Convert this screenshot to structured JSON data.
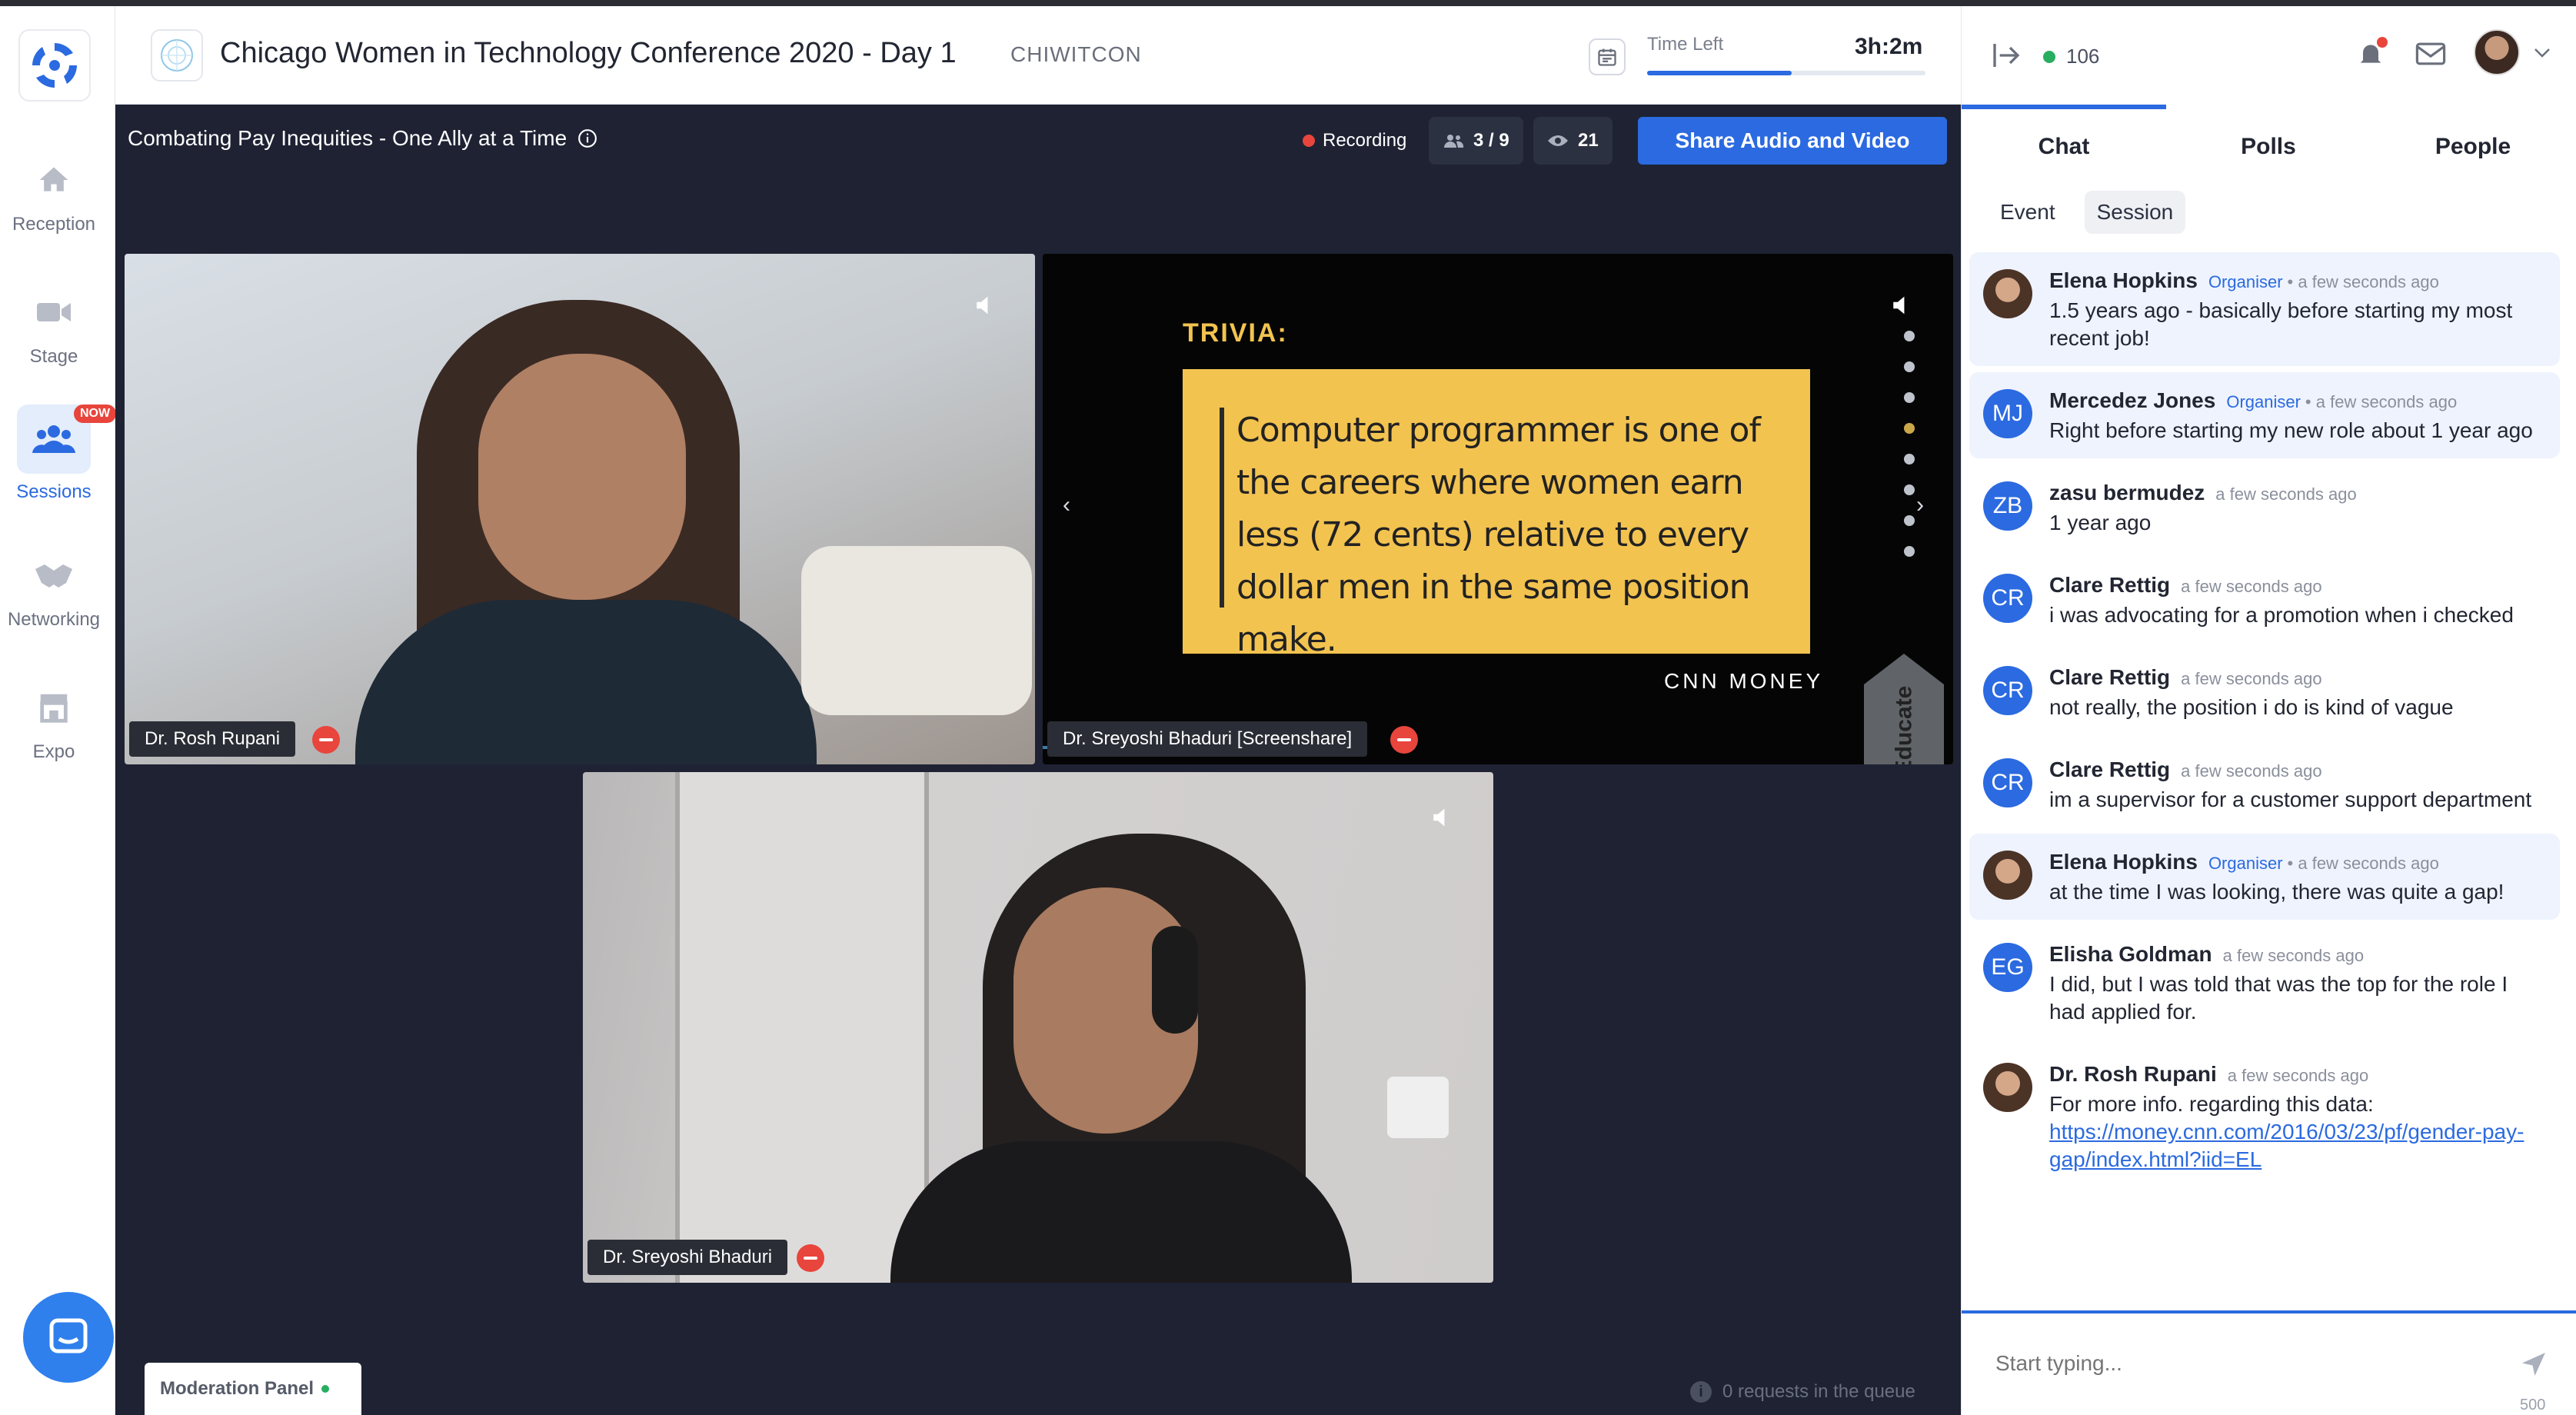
{
  "nav": {
    "items": [
      {
        "label": "Reception",
        "icon": "home-icon"
      },
      {
        "label": "Stage",
        "icon": "video-camera-icon"
      },
      {
        "label": "Sessions",
        "icon": "group-icon",
        "badge": "NOW"
      },
      {
        "label": "Networking",
        "icon": "handshake-icon"
      },
      {
        "label": "Expo",
        "icon": "store-icon"
      }
    ]
  },
  "header": {
    "title": "Chicago Women in Technology Conference 2020 - Day 1",
    "code": "CHIWITCON",
    "time_left_label": "Time Left",
    "time_left_value": "3h:2m",
    "time_progress": 0.52
  },
  "stage": {
    "session_title": "Combating Pay Inequities - One Ally at a Time",
    "recording_label": "Recording",
    "participants": "3 / 9",
    "viewers": "21",
    "share_button": "Share Audio and Video",
    "tiles": [
      {
        "name": "Dr. Rosh Rupani"
      },
      {
        "name": "Dr. Sreyoshi Bhaduri [Screenshare]"
      },
      {
        "name": "Dr. Sreyoshi Bhaduri"
      }
    ],
    "slide": {
      "heading": "TRIVIA:",
      "body": "Computer programmer is one of the careers where women earn less (72 cents) relative to every dollar men in the same position make.",
      "source": "CNN MONEY",
      "brand": "Educate"
    },
    "moderation_panel": "Moderation Panel",
    "queue_text": "0 requests in the queue"
  },
  "right": {
    "online_count": "106",
    "tabs": [
      "Chat",
      "Polls",
      "People"
    ],
    "subtabs": [
      "Event",
      "Session"
    ],
    "messages": [
      {
        "name": "Elena Hopkins",
        "role": "Organiser",
        "time": "a few seconds ago",
        "text": "1.5 years ago - basically before starting my most recent job!",
        "initials": ""
      },
      {
        "name": "Mercedez Jones",
        "role": "Organiser",
        "time": "a few seconds ago",
        "text": "Right before starting my new role about 1 year ago",
        "initials": "MJ"
      },
      {
        "name": "zasu bermudez",
        "role": "",
        "time": "a few seconds ago",
        "text": "1 year ago",
        "initials": "ZB"
      },
      {
        "name": "Clare Rettig",
        "role": "",
        "time": "a few seconds ago",
        "text": "i was advocating for a promotion when i checked",
        "initials": "CR"
      },
      {
        "name": "Clare Rettig",
        "role": "",
        "time": "a few seconds ago",
        "text": "not really, the position i do is kind of vague",
        "initials": "CR"
      },
      {
        "name": "Clare Rettig",
        "role": "",
        "time": "a few seconds ago",
        "text": "im a supervisor for a customer support department",
        "initials": "CR"
      },
      {
        "name": "Elena Hopkins",
        "role": "Organiser",
        "time": "a few seconds ago",
        "text": "at the time I was looking, there was quite a gap!",
        "initials": ""
      },
      {
        "name": "Elisha Goldman",
        "role": "",
        "time": "a few seconds ago",
        "text": "I did, but I was told that was the top for the role I had applied for.",
        "initials": "EG"
      },
      {
        "name": "Dr. Rosh Rupani",
        "role": "",
        "time": "a few seconds ago",
        "text": "For more info. regarding this data:",
        "link": "https://money.cnn.com/2016/03/23/pf/gender-pay-gap/index.html?iid=EL",
        "initials": ""
      }
    ],
    "composer_placeholder": "Start typing...",
    "char_count": "500"
  },
  "colors": {
    "accent": "#2b6ae0",
    "stage_bg": "#1e2233",
    "recording": "#e8453c",
    "slide": "#f3c350"
  }
}
